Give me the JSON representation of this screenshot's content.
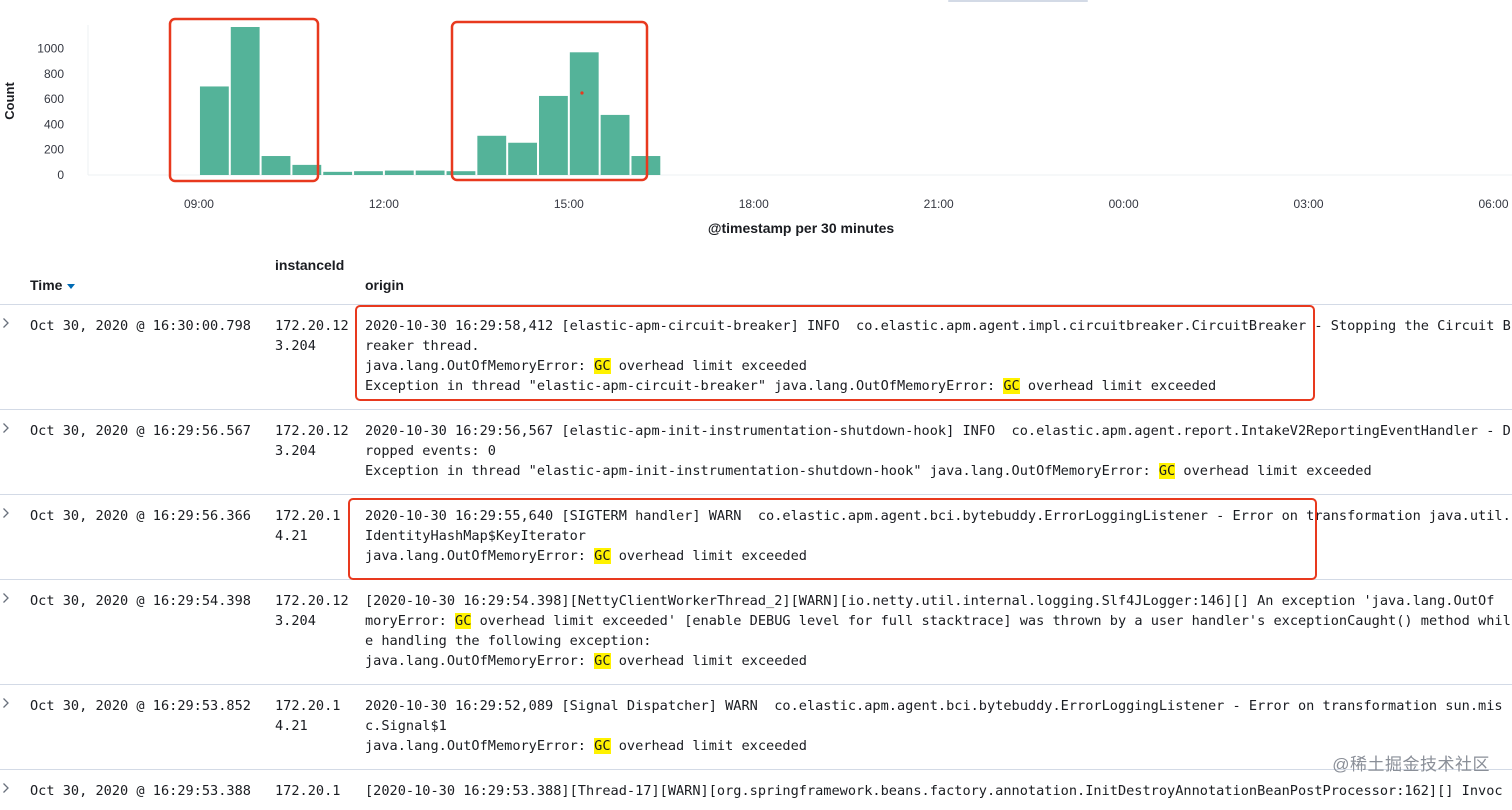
{
  "chart_data": {
    "type": "bar",
    "ylabel": "Count",
    "xlabel": "@timestamp per 30 minutes",
    "yticks": [
      0,
      200,
      400,
      600,
      800,
      1000
    ],
    "xticks": [
      "09:00",
      "12:00",
      "15:00",
      "18:00",
      "21:00",
      "00:00",
      "03:00",
      "06:00"
    ],
    "ylim": [
      0,
      1170
    ],
    "x_range_hours": [
      7.2,
      30.3
    ],
    "bar_width_hours": 0.5,
    "bar_color": "#54b399",
    "bars": [
      {
        "start": 9.0,
        "value": 700
      },
      {
        "start": 9.5,
        "value": 1170
      },
      {
        "start": 10.0,
        "value": 150
      },
      {
        "start": 10.5,
        "value": 80
      },
      {
        "start": 11.0,
        "value": 25
      },
      {
        "start": 11.5,
        "value": 30
      },
      {
        "start": 12.0,
        "value": 35
      },
      {
        "start": 12.5,
        "value": 35
      },
      {
        "start": 13.0,
        "value": 30
      },
      {
        "start": 13.5,
        "value": 310
      },
      {
        "start": 14.0,
        "value": 255
      },
      {
        "start": 14.5,
        "value": 625
      },
      {
        "start": 15.0,
        "value": 970
      },
      {
        "start": 15.5,
        "value": 475
      },
      {
        "start": 16.0,
        "value": 150
      }
    ],
    "highlight_color": "#e8391e"
  },
  "table": {
    "headers": {
      "time": "Time",
      "instance": "instanceId",
      "origin": "origin"
    },
    "rows": [
      {
        "time": "Oct 30, 2020 @ 16:30:00.798",
        "instance": "172.20.123.204",
        "lines": [
          [
            {
              "t": "2020-10-30 16:29:58,412 [elastic-apm-circuit-breaker] INFO  co.elastic.apm.agent.impl.circuitbreaker.CircuitBreaker - Stopping the Circuit B"
            }
          ],
          [
            {
              "t": "reaker thread."
            }
          ],
          [
            {
              "t": "java.lang.OutOfMemoryError: "
            },
            {
              "t": "GC",
              "hl": true
            },
            {
              "t": " overhead limit exceeded"
            }
          ],
          [
            {
              "t": "Exception in thread \"elastic-apm-circuit-breaker\" java.lang.OutOfMemoryError: "
            },
            {
              "t": "GC",
              "hl": true
            },
            {
              "t": " overhead limit exceeded"
            }
          ]
        ]
      },
      {
        "time": "Oct 30, 2020 @ 16:29:56.567",
        "instance": "172.20.123.204",
        "lines": [
          [
            {
              "t": "2020-10-30 16:29:56,567 [elastic-apm-init-instrumentation-shutdown-hook] INFO  co.elastic.apm.agent.report.IntakeV2ReportingEventHandler - D"
            }
          ],
          [
            {
              "t": "ropped events: 0"
            }
          ],
          [
            {
              "t": "Exception in thread \"elastic-apm-init-instrumentation-shutdown-hook\" java.lang.OutOfMemoryError: "
            },
            {
              "t": "GC",
              "hl": true
            },
            {
              "t": " overhead limit exceeded"
            }
          ]
        ]
      },
      {
        "time": "Oct 30, 2020 @ 16:29:56.366",
        "instance": "172.20.14.21",
        "lines": [
          [
            {
              "t": "2020-10-30 16:29:55,640 [SIGTERM handler] WARN  co.elastic.apm.agent.bci.bytebuddy.ErrorLoggingListener - Error on transformation java.util."
            }
          ],
          [
            {
              "t": "IdentityHashMap$KeyIterator"
            }
          ],
          [
            {
              "t": "java.lang.OutOfMemoryError: "
            },
            {
              "t": "GC",
              "hl": true
            },
            {
              "t": " overhead limit exceeded"
            }
          ]
        ]
      },
      {
        "time": "Oct 30, 2020 @ 16:29:54.398",
        "instance": "172.20.123.204",
        "lines": [
          [
            {
              "t": "[2020-10-30 16:29:54.398][NettyClientWorkerThread_2][WARN][io.netty.util.internal.logging.Slf4JLogger:146][] An exception 'java.lang.OutOf"
            }
          ],
          [
            {
              "t": "moryError: "
            },
            {
              "t": "GC",
              "hl": true
            },
            {
              "t": " overhead limit exceeded' [enable DEBUG level for full stacktrace] was thrown by a user handler's exceptionCaught() method whil"
            }
          ],
          [
            {
              "t": "e handling the following exception:"
            }
          ],
          [
            {
              "t": "java.lang.OutOfMemoryError: "
            },
            {
              "t": "GC",
              "hl": true
            },
            {
              "t": " overhead limit exceeded"
            }
          ]
        ]
      },
      {
        "time": "Oct 30, 2020 @ 16:29:53.852",
        "instance": "172.20.14.21",
        "lines": [
          [
            {
              "t": "2020-10-30 16:29:52,089 [Signal Dispatcher] WARN  co.elastic.apm.agent.bci.bytebuddy.ErrorLoggingListener - Error on transformation sun.mis"
            }
          ],
          [
            {
              "t": "c.Signal$1"
            }
          ],
          [
            {
              "t": "java.lang.OutOfMemoryError: "
            },
            {
              "t": "GC",
              "hl": true
            },
            {
              "t": " overhead limit exceeded"
            }
          ]
        ]
      },
      {
        "time": "Oct 30, 2020 @ 16:29:53.388",
        "instance": "172.20.1",
        "lines": [
          [
            {
              "t": "[2020-10-30 16:29:53.388][Thread-17][WARN][org.springframework.beans.factory.annotation.InitDestroyAnnotationBeanPostProcessor:162][] Invoc"
            }
          ]
        ]
      }
    ],
    "highlight_color": "#fff200"
  },
  "watermark": "@稀土掘金技术社区"
}
